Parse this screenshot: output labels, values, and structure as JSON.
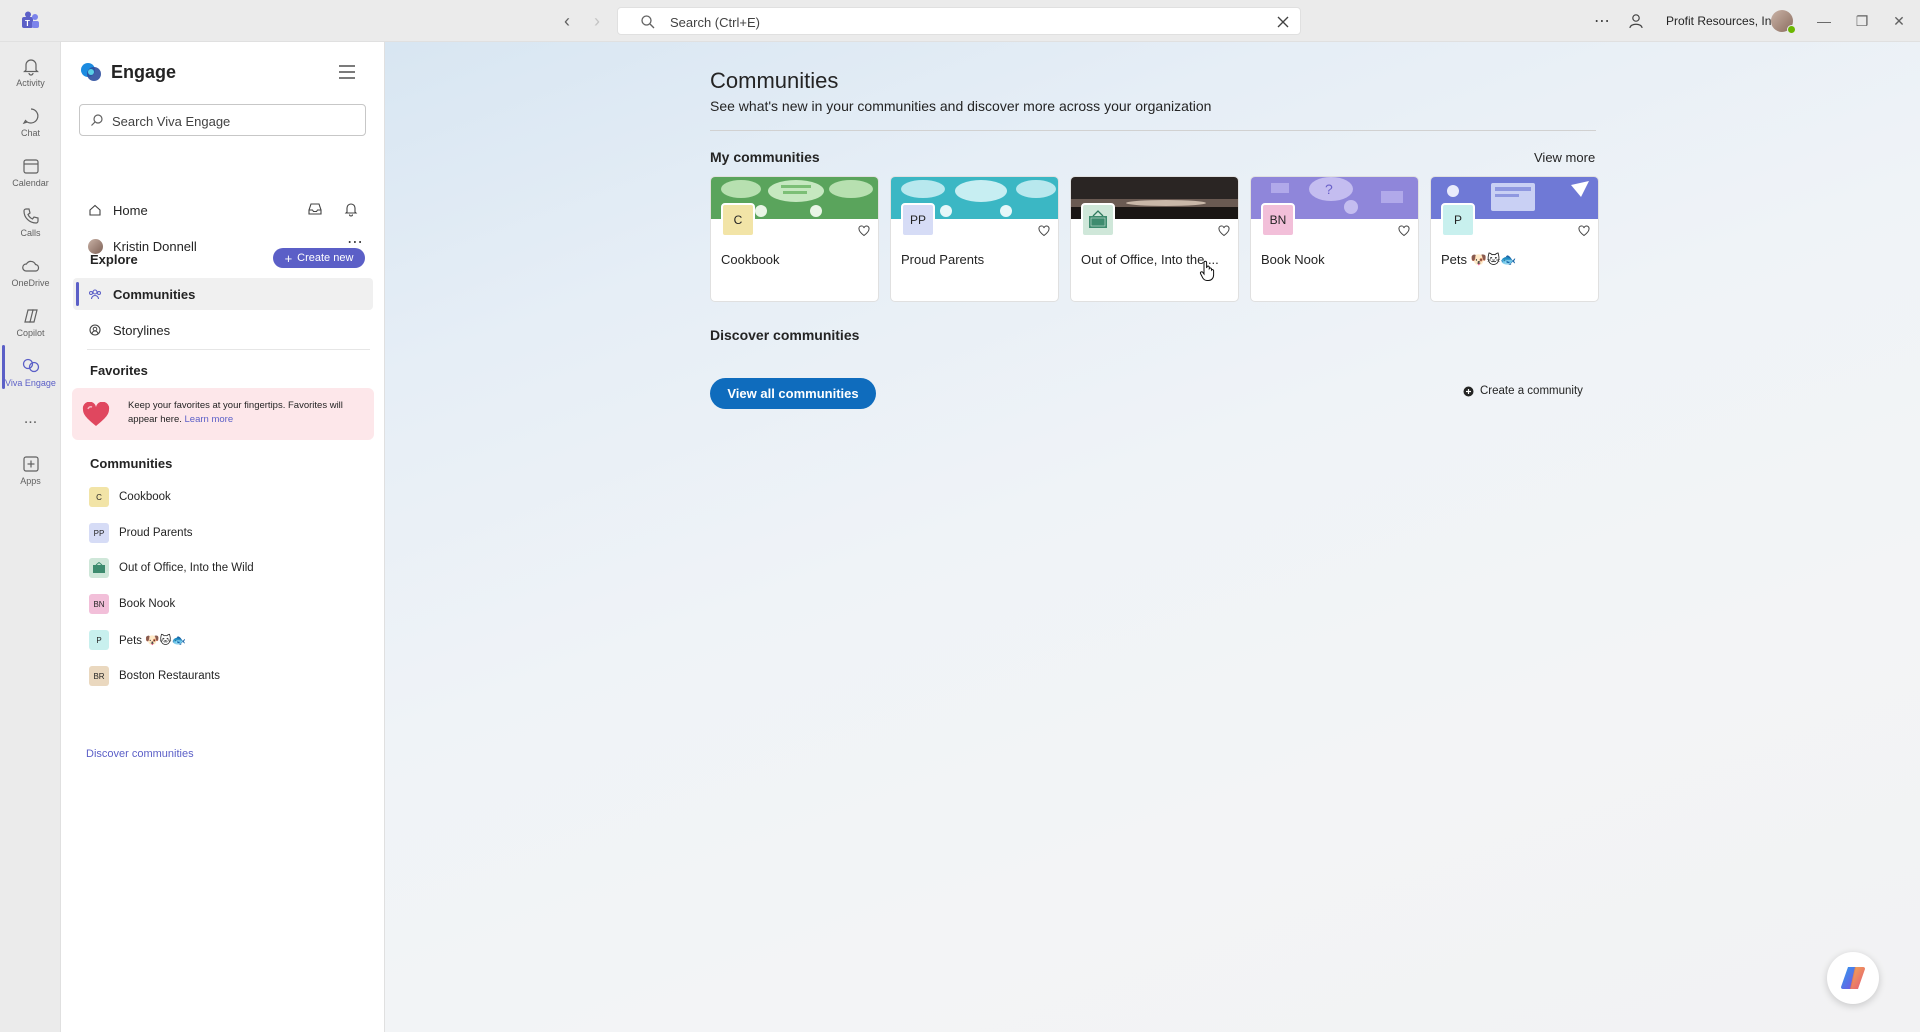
{
  "titlebar": {
    "search_placeholder": "Search (Ctrl+E)",
    "org_name": "Profit Resources, Inc."
  },
  "rail": {
    "items": [
      {
        "label": "Activity",
        "icon": "bell-icon"
      },
      {
        "label": "Chat",
        "icon": "chat-icon"
      },
      {
        "label": "Calendar",
        "icon": "calendar-icon"
      },
      {
        "label": "Calls",
        "icon": "phone-icon"
      },
      {
        "label": "OneDrive",
        "icon": "cloud-icon"
      },
      {
        "label": "Copilot",
        "icon": "copilot-icon"
      },
      {
        "label": "Viva Engage",
        "icon": "engage-icon"
      },
      {
        "label": "Apps",
        "icon": "add-app-icon"
      }
    ],
    "more": "..."
  },
  "pane": {
    "brand": "Engage",
    "search_placeholder": "Search Viva Engage",
    "home": "Home",
    "user": "Kristin Donnell",
    "explore_header": "Explore",
    "create_new": "Create new",
    "explore_items": [
      "Communities",
      "Storylines"
    ],
    "favorites_header": "Favorites",
    "favorites_text": "Keep your favorites at your fingertips. Favorites will appear here.",
    "favorites_link": "Learn more",
    "communities_header": "Communities",
    "communities": [
      {
        "initials": "C",
        "name": "Cookbook",
        "color": "#f2e4a7"
      },
      {
        "initials": "PP",
        "name": "Proud Parents",
        "color": "#d6dcf6"
      },
      {
        "initials": "",
        "name": "Out of Office, Into the Wild",
        "color": "#cfe7d9"
      },
      {
        "initials": "BN",
        "name": "Book Nook",
        "color": "#f2bfd9"
      },
      {
        "initials": "P",
        "name": "Pets 🐶🐱🐟",
        "color": "#c8f0ee"
      },
      {
        "initials": "BR",
        "name": "Boston Restaurants",
        "color": "#ead8bf"
      }
    ],
    "discover_link": "Discover communities"
  },
  "main": {
    "title": "Communities",
    "subtitle": "See what's new in your communities and discover more across your organization",
    "my_communities": "My communities",
    "view_more": "View more",
    "cards": [
      {
        "initials": "C",
        "name": "Cookbook",
        "logo_color": "#f2e4a7",
        "banner": "#5aa45c"
      },
      {
        "initials": "PP",
        "name": "Proud Parents",
        "logo_color": "#d6dcf6",
        "banner": "#3bb7c4"
      },
      {
        "initials": "",
        "name": "Out of Office, Into the ...",
        "logo_color": "#cfe7d9",
        "banner": "#2a2523"
      },
      {
        "initials": "BN",
        "name": "Book Nook",
        "logo_color": "#f2bfd9",
        "banner": "#8f86da"
      },
      {
        "initials": "P",
        "name": "Pets 🐶🐱🐟",
        "logo_color": "#c8f0ee",
        "banner": "#6f79d6"
      }
    ],
    "discover": "Discover communities",
    "view_all": "View all communities",
    "create_community": "Create a community"
  },
  "colors": {
    "accent": "#5b5fc7",
    "primary_button": "#0f6cbd"
  }
}
